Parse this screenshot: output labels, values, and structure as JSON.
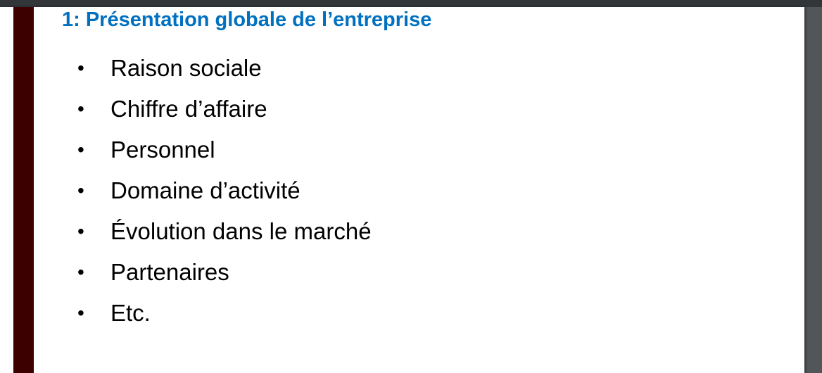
{
  "slide": {
    "title": "1: Présentation globale de l’entreprise",
    "bullet_glyph": "•",
    "items": [
      "Raison sociale",
      "Chiffre d’affaire",
      "Personnel",
      "Domaine d’activité",
      "Évolution dans le marché",
      "Partenaires",
      "Etc."
    ]
  },
  "colors": {
    "title": "#0070c0",
    "accent_bar": "#3d0000",
    "viewer_bg": "#525659"
  }
}
